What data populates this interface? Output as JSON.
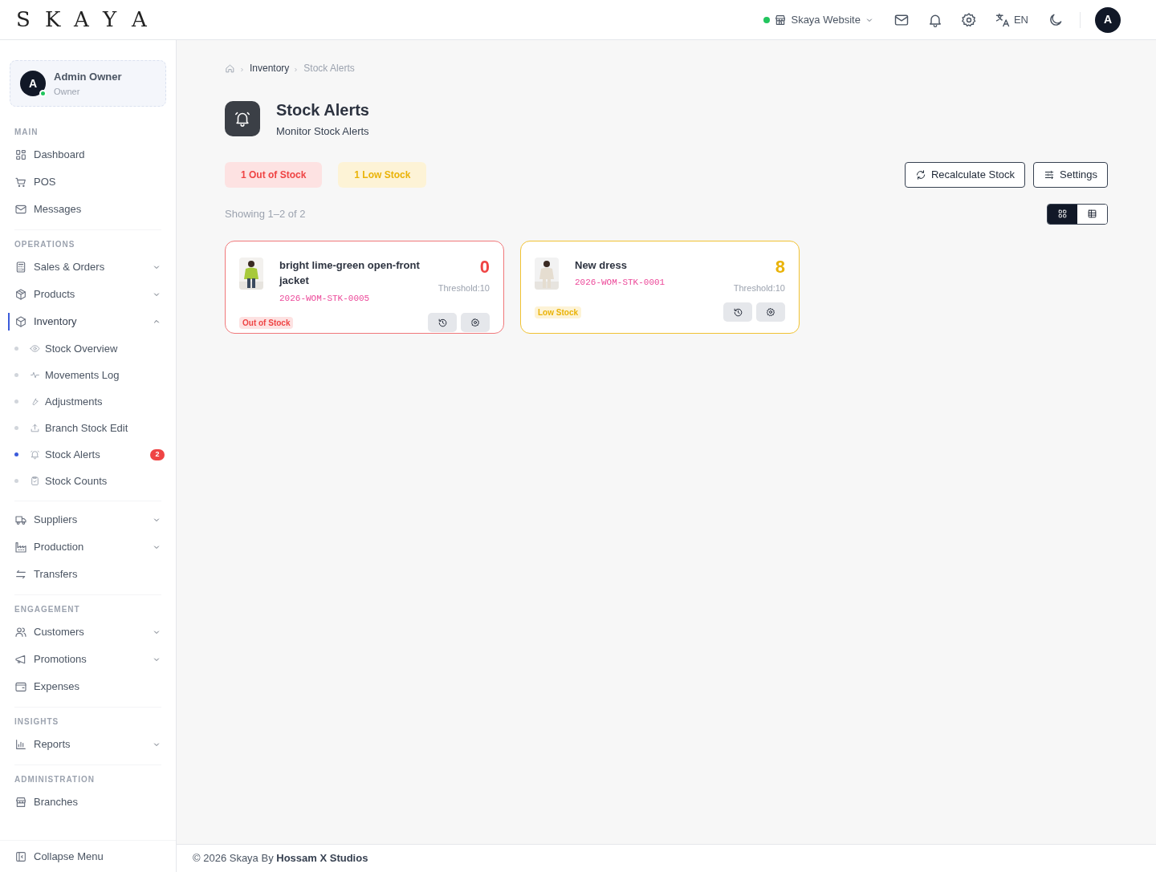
{
  "logo": [
    "S",
    "K",
    "A",
    "Y",
    "A"
  ],
  "topbar": {
    "store": "Skaya Website",
    "store_online": true,
    "language": "EN",
    "avatar": "A"
  },
  "user": {
    "initial": "A",
    "name": "Admin Owner",
    "role": "Owner",
    "online": true
  },
  "sidebar": [
    {
      "heading": "MAIN",
      "items": [
        {
          "label": "Dashboard",
          "selected": false
        },
        {
          "label": "POS",
          "selected": false
        },
        {
          "label": "Messages",
          "selected": false
        }
      ]
    },
    {
      "heading": "OPERATIONS",
      "items": [
        {
          "label": "Sales & Orders",
          "selected": false,
          "expanded": false
        },
        {
          "label": "Products",
          "selected": false,
          "expanded": false
        },
        {
          "label": "Inventory",
          "selected": true,
          "expanded": true,
          "children": [
            {
              "label": "Stock Overview",
              "selected": false
            },
            {
              "label": "Movements Log",
              "selected": false
            },
            {
              "label": "Adjustments",
              "selected": false
            },
            {
              "label": "Branch Stock Edit",
              "selected": false
            },
            {
              "label": "Stock Alerts",
              "selected": true,
              "badge": "2"
            },
            {
              "label": "Stock Counts",
              "selected": false
            }
          ]
        }
      ]
    },
    {
      "items": [
        {
          "label": "Suppliers",
          "selected": false,
          "expanded": false
        },
        {
          "label": "Production",
          "selected": false,
          "expanded": false
        },
        {
          "label": "Transfers",
          "selected": false
        }
      ]
    },
    {
      "heading": "ENGAGEMENT",
      "items": [
        {
          "label": "Customers",
          "selected": false,
          "expanded": false
        },
        {
          "label": "Promotions",
          "selected": false,
          "expanded": false
        },
        {
          "label": "Expenses",
          "selected": false
        }
      ]
    },
    {
      "heading": "INSIGHTS",
      "items": [
        {
          "label": "Reports",
          "selected": false,
          "expanded": false
        }
      ]
    },
    {
      "heading": "ADMINISTRATION",
      "items": [
        {
          "label": "Branches",
          "selected": false
        }
      ]
    }
  ],
  "collapse_label": "Collapse Menu",
  "breadcrumb": [
    "Inventory",
    "Stock Alerts"
  ],
  "page": {
    "title": "Stock Alerts",
    "subtitle": "Monitor Stock Alerts"
  },
  "summary": [
    {
      "kind": "out",
      "label": "1 Out of Stock"
    },
    {
      "kind": "low",
      "label": "1 Low Stock"
    }
  ],
  "actions": [
    "Recalculate Stock",
    "Settings"
  ],
  "showing": "Showing 1–2 of 2",
  "views": [
    {
      "kind": "grid",
      "selected": true
    },
    {
      "kind": "table",
      "selected": false
    }
  ],
  "cards": [
    {
      "kind": "out",
      "name": "bright lime-green open-front jacket",
      "sku": "2026-WOM-STK-0005",
      "quantity": "0",
      "threshold": "Threshold:10",
      "status": "Out of Stock"
    },
    {
      "kind": "low",
      "name": "New dress",
      "sku": "2026-WOM-STK-0001",
      "quantity": "8",
      "threshold": "Threshold:10",
      "status": "Low Stock"
    }
  ],
  "footer": {
    "text": "© 2026 Skaya By",
    "author": "Hossam X Studios"
  }
}
